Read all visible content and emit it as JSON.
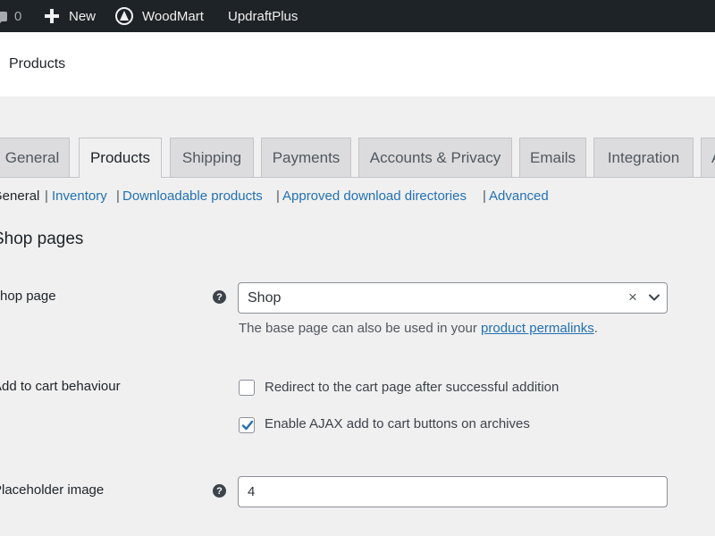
{
  "admin_bar": {
    "comments_count": "0",
    "new_label": "New",
    "woodmart_label": "WoodMart",
    "updraftplus_label": "UpdraftPlus"
  },
  "page": {
    "title": "Products"
  },
  "tabs": [
    {
      "label": "General"
    },
    {
      "label": "Products",
      "active": true
    },
    {
      "label": "Shipping"
    },
    {
      "label": "Payments"
    },
    {
      "label": "Accounts & Privacy"
    },
    {
      "label": "Emails"
    },
    {
      "label": "Integration"
    },
    {
      "label": "A"
    }
  ],
  "subnav": {
    "current": "General",
    "separator": "|",
    "links": [
      "Inventory",
      "Downloadable products",
      "Approved download directories",
      "Advanced"
    ]
  },
  "section": {
    "heading": "Shop pages"
  },
  "shop_page": {
    "label": "Shop page",
    "help_glyph": "?",
    "selected_value": "Shop",
    "clear_glyph": "×",
    "description_prefix": "The base page can also be used in your ",
    "description_link": "product permalinks",
    "description_suffix": "."
  },
  "add_to_cart": {
    "label": "Add to cart behaviour",
    "options": [
      {
        "label": "Redirect to the cart page after successful addition",
        "checked": false
      },
      {
        "label": "Enable AJAX add to cart buttons on archives",
        "checked": true
      }
    ]
  },
  "placeholder_image": {
    "label": "Placeholder image",
    "help_glyph": "?",
    "value": "4"
  },
  "colors": {
    "admin_bar_bg": "#1d2327",
    "link": "#2271b1",
    "page_bg": "#f0f0f1",
    "tab_bg": "#dcdcde"
  }
}
